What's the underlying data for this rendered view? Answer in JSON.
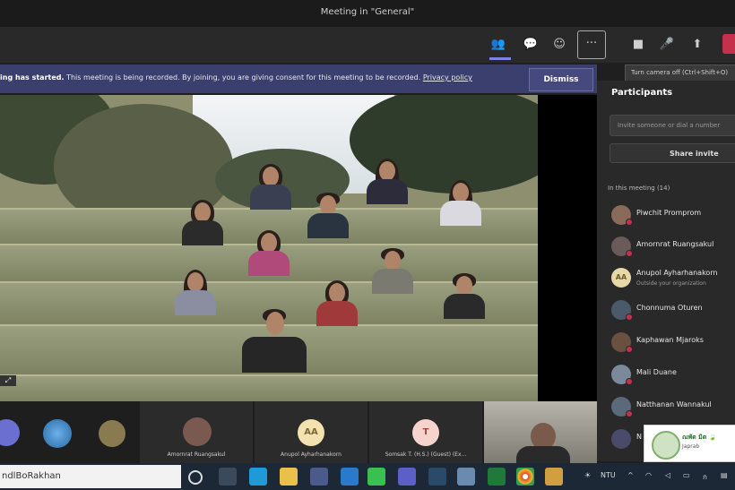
{
  "window": {
    "title": "Meeting in \"General\""
  },
  "toolbar": {
    "items": [
      {
        "name": "participants-icon",
        "glyph": "👥"
      },
      {
        "name": "chat-icon",
        "glyph": "💬"
      },
      {
        "name": "reactions-icon",
        "glyph": "☺"
      },
      {
        "name": "more-icon",
        "glyph": "···"
      },
      {
        "name": "camera-icon",
        "glyph": "■"
      },
      {
        "name": "mic-off-icon",
        "glyph": "🎤"
      },
      {
        "name": "share-tray-icon",
        "glyph": "⬆"
      }
    ],
    "tooltip": "Turn camera off (Ctrl+Shift+O)"
  },
  "banner": {
    "bold": "ing has started.",
    "text": "This meeting is being recorded. By joining, you are giving consent for this meeting to be recorded.",
    "link": "Privacy policy",
    "dismiss": "Dismiss"
  },
  "stage": {
    "badge": "⤢"
  },
  "participants_panel": {
    "title": "Participants",
    "invite_placeholder": "Invite someone or dial a number",
    "share_invite": "Share invite",
    "section": "In this meeting (14)",
    "people": [
      {
        "name": "Piwchit Promprom",
        "sub": "",
        "color": "#8a6a5a"
      },
      {
        "name": "Amornrat Ruangsakul",
        "sub": "",
        "color": "#6b5a5a"
      },
      {
        "name": "Anupol Ayharhanakorn",
        "sub": "Outside your organization",
        "color": "#e7d8a8",
        "initials": "AA"
      },
      {
        "name": "Chonnuma Oturen",
        "sub": "",
        "color": "#4a5a6a"
      },
      {
        "name": "Kaphawan Mjaroks",
        "sub": "",
        "color": "#6a5040"
      },
      {
        "name": "Mali Duane",
        "sub": "",
        "color": "#7a8a9a"
      },
      {
        "name": "Natthanan Wannakul",
        "sub": "",
        "color": "#5a6a7a"
      },
      {
        "name": "N",
        "sub": "",
        "color": "#4a4a6a"
      }
    ]
  },
  "strip": {
    "tiles": [
      {
        "label": "",
        "kind": "avatar",
        "color": "#6b6fcf"
      },
      {
        "label": "",
        "kind": "avatar",
        "color": "#3a8ad0"
      },
      {
        "label": "",
        "kind": "avatar",
        "color": "#8a7a50"
      },
      {
        "label": "Amornrat Ruangsakul",
        "kind": "avatar",
        "color": "#7a5a50"
      },
      {
        "label": "Anupol Ayharhanakorn",
        "kind": "initials",
        "initials": "AA",
        "color": "#f3e1b0"
      },
      {
        "label": "Somsak T. (H.S.) (Guest) (Ex...",
        "kind": "initials",
        "initials": "T",
        "color": "#f6d3cc"
      }
    ]
  },
  "notification": {
    "title": "ณพัต มิต 🍃",
    "subtitle": "Japrab"
  },
  "taskbar": {
    "search": "ndlBoRakhan",
    "time": "NTU"
  }
}
